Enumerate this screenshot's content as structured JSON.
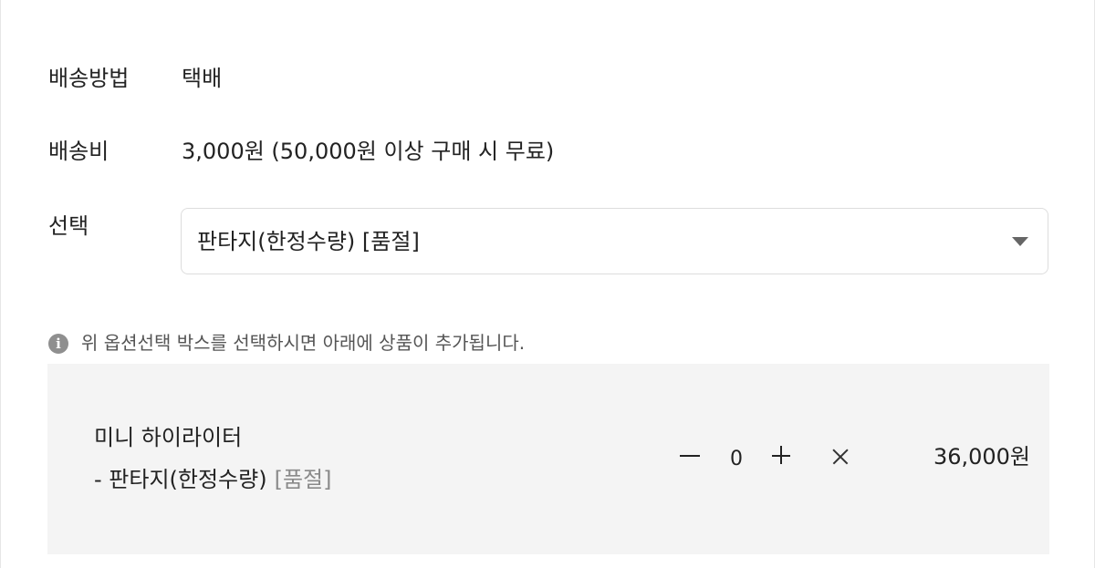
{
  "shipping": {
    "method_label": "배송방법",
    "method_value": "택배",
    "fee_label": "배송비",
    "fee_value": "3,000원 (50,000원 이상 구매 시 무료)"
  },
  "option_select": {
    "label": "선택",
    "selected_value": "판타지(한정수량) [품절]"
  },
  "notice": {
    "icon": "info-icon",
    "icon_glyph": "i",
    "text": "위 옵션선택 박스를 선택하시면 아래에 상품이 추가됩니다."
  },
  "selected_item": {
    "name": "미니 하이라이터",
    "option": "- 판타지(한정수량)",
    "soldout_tag": "[품절]",
    "quantity": "0",
    "price": "36,000원"
  }
}
